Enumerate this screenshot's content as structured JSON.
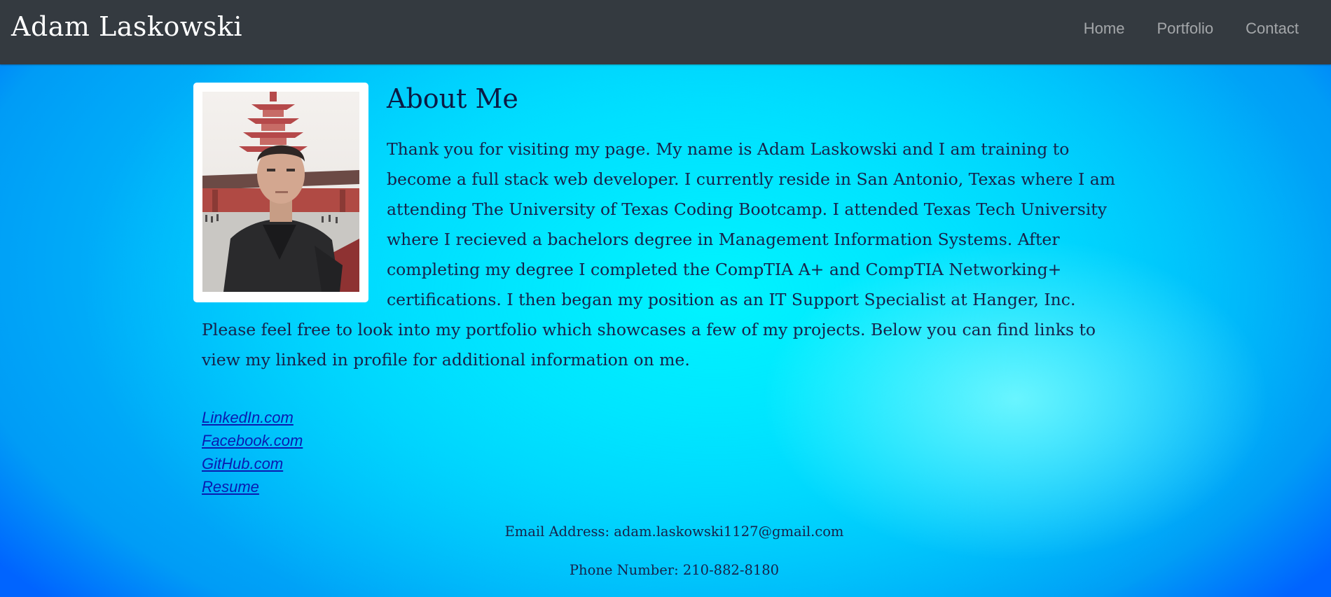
{
  "navbar": {
    "brand": "Adam Laskowski",
    "links": [
      {
        "label": "Home"
      },
      {
        "label": "Portfolio"
      },
      {
        "label": "Contact"
      }
    ]
  },
  "about": {
    "heading": "About Me",
    "bio": "Thank you for visiting my page. My name is Adam Laskowski and I am training to become a full stack web developer. I currently reside in San Antonio, Texas where I am attending The University of Texas Coding Bootcamp. I attended Texas Tech University where I recieved a bachelors degree in Management Information Systems. After completing my degree I completed the CompTIA A+ and CompTIA Networking+ certifications. I then began my position as an IT Support Specialist at Hanger, Inc. Please feel free to look into my portfolio which showcases a few of my projects. Below you can find links to view my linked in profile for additional information on me."
  },
  "links": [
    {
      "label": "LinkedIn.com"
    },
    {
      "label": "Facebook.com"
    },
    {
      "label": "GitHub.com"
    },
    {
      "label": "Resume"
    }
  ],
  "contact": {
    "email": "Email Address: adam.laskowski1127@gmail.com",
    "phone": "Phone Number: 210-882-8180"
  },
  "colors": {
    "navbar_bg": "#343a40",
    "link": "#0a1bb0",
    "text": "#17224a"
  }
}
